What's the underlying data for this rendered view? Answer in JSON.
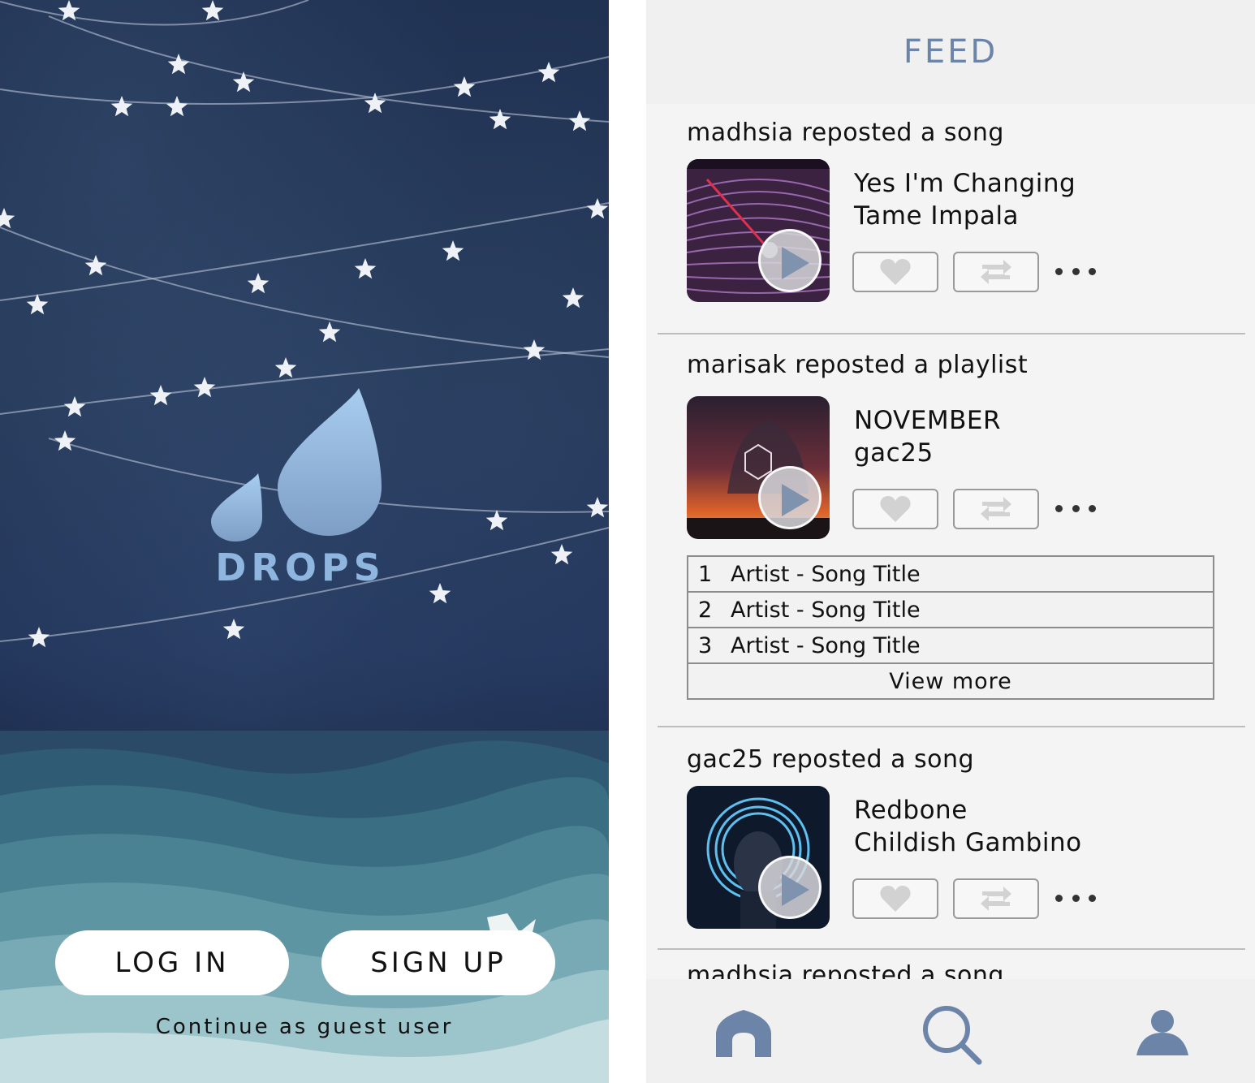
{
  "login": {
    "logo_text": "DROPS",
    "login_label": "LOG IN",
    "signup_label": "SIGN UP",
    "guest_label": "Continue as guest user",
    "colors": {
      "sky": "#22345a",
      "logo": "#8fb6df",
      "sea": "#5a9aa8"
    }
  },
  "feed": {
    "title": "FEED",
    "posts": [
      {
        "repost": "madhsia reposted a song",
        "title": "Yes I'm Changing",
        "artist": "Tame Impala"
      },
      {
        "repost": "marisak reposted a playlist",
        "title": "NOVEMBER",
        "artist": "gac25",
        "tracks": [
          {
            "num": "1",
            "label": "Artist - Song Title"
          },
          {
            "num": "2",
            "label": "Artist - Song Title"
          },
          {
            "num": "3",
            "label": "Artist - Song Title"
          }
        ],
        "view_more": "View more"
      },
      {
        "repost": "gac25 reposted a song",
        "title": "Redbone",
        "artist": "Childish Gambino"
      },
      {
        "repost": "madhsia reposted a song"
      }
    ],
    "icons": {
      "like": "heart-icon",
      "repost": "repost-icon",
      "more": "more-icon",
      "play": "play-icon"
    }
  },
  "tabbar": {
    "items": [
      {
        "icon": "home-icon"
      },
      {
        "icon": "search-icon"
      },
      {
        "icon": "profile-icon"
      }
    ],
    "color": "#6b84a8"
  }
}
